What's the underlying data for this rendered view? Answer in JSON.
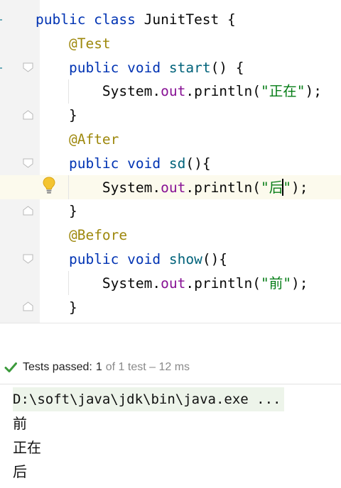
{
  "editor": {
    "lines": [
      {
        "parts": [
          {
            "t": "public class ",
            "c": "kw"
          },
          {
            "t": "JunitTest {",
            "c": ""
          }
        ]
      },
      {
        "parts": [
          {
            "t": "    ",
            "c": ""
          },
          {
            "t": "@Test",
            "c": "ann"
          }
        ]
      },
      {
        "parts": [
          {
            "t": "    ",
            "c": ""
          },
          {
            "t": "public void ",
            "c": "kw"
          },
          {
            "t": "start",
            "c": "fn"
          },
          {
            "t": "() {",
            "c": ""
          }
        ]
      },
      {
        "parts": [
          {
            "t": "        System.",
            "c": ""
          },
          {
            "t": "out",
            "c": "fld"
          },
          {
            "t": ".println(",
            "c": ""
          },
          {
            "t": "\"正在\"",
            "c": "str"
          },
          {
            "t": ");",
            "c": ""
          }
        ]
      },
      {
        "parts": [
          {
            "t": "    }",
            "c": ""
          }
        ]
      },
      {
        "parts": [
          {
            "t": "    ",
            "c": ""
          },
          {
            "t": "@After",
            "c": "ann"
          }
        ]
      },
      {
        "parts": [
          {
            "t": "    ",
            "c": ""
          },
          {
            "t": "public void ",
            "c": "kw"
          },
          {
            "t": "sd",
            "c": "fn"
          },
          {
            "t": "(){",
            "c": ""
          }
        ]
      },
      {
        "parts": [
          {
            "t": "        System.",
            "c": ""
          },
          {
            "t": "out",
            "c": "fld"
          },
          {
            "t": ".println(",
            "c": ""
          },
          {
            "t": "\"后",
            "c": "str"
          },
          {
            "t": "",
            "c": "caret"
          },
          {
            "t": "\"",
            "c": "str"
          },
          {
            "t": ");",
            "c": ""
          }
        ]
      },
      {
        "parts": [
          {
            "t": "    }",
            "c": ""
          }
        ]
      },
      {
        "parts": [
          {
            "t": "    ",
            "c": ""
          },
          {
            "t": "@Before",
            "c": "ann"
          }
        ]
      },
      {
        "parts": [
          {
            "t": "    ",
            "c": ""
          },
          {
            "t": "public void ",
            "c": "kw"
          },
          {
            "t": "show",
            "c": "fn"
          },
          {
            "t": "(){",
            "c": ""
          }
        ]
      },
      {
        "parts": [
          {
            "t": "        System.",
            "c": ""
          },
          {
            "t": "out",
            "c": "fld"
          },
          {
            "t": ".println(",
            "c": ""
          },
          {
            "t": "\"前\"",
            "c": "str"
          },
          {
            "t": ");",
            "c": ""
          }
        ]
      },
      {
        "parts": [
          {
            "t": "    }",
            "c": ""
          }
        ]
      }
    ],
    "icons": {
      "fold": "fold-marker-icon",
      "intention": "lightbulb-icon"
    },
    "colors": {
      "keyword": "#0033b3",
      "annotation": "#9e880d",
      "method": "#00627a",
      "field": "#871094",
      "string": "#067d17"
    }
  },
  "run": {
    "status_label": "Tests passed:",
    "status_count": "1",
    "status_rest": "of 1 test – 12 ms",
    "status_icon": "check-icon",
    "pass_color": "#3c9a3c",
    "console": {
      "command": "D:\\soft\\java\\jdk\\bin\\java.exe ...",
      "output": [
        "前",
        "正在",
        "后"
      ]
    }
  }
}
